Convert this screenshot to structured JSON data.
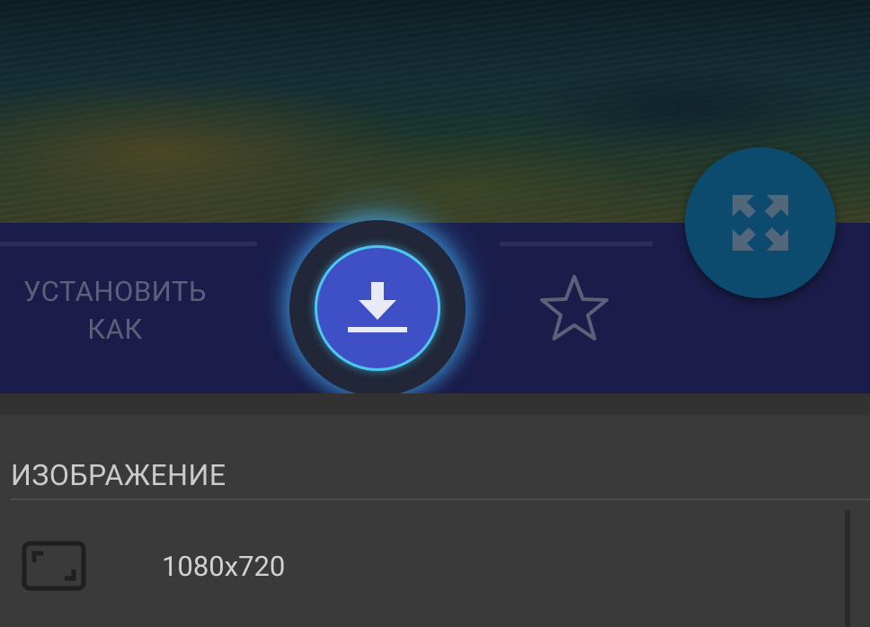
{
  "action_bar": {
    "set_as_line1": "УСТАНОВИТЬ",
    "set_as_line2": "КАК",
    "download_icon": "download-icon",
    "favorite_icon": "star-outline-icon",
    "fullscreen_icon": "expand-arrows-icon"
  },
  "details": {
    "section_title": "ИЗОБРАЖЕНИЕ",
    "resolution_icon": "aspect-ratio-icon",
    "resolution_value": "1080x720"
  },
  "colors": {
    "action_bar": "#1a1d49",
    "download_button": "#3f50c6",
    "highlight_ring": "#4cc7f2",
    "fab": "#0d4b6e",
    "panel": "#3a3a3a"
  }
}
